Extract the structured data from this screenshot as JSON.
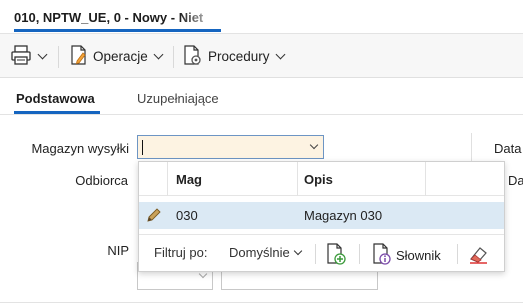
{
  "window": {
    "tab_title": "010, NPTW_UE, 0 - Nowy - Niet"
  },
  "toolbar": {
    "print_icon": "printer-icon",
    "operations_label": "Operacje",
    "procedures_label": "Procedury"
  },
  "section_tabs": {
    "basic": "Podstawowa",
    "additional": "Uzupełniające"
  },
  "form": {
    "warehouse_label": "Magazyn wysyłki",
    "warehouse_value": "",
    "recipient_label": "Odbiorca",
    "nip_label": "NIP",
    "date_label_1": "Data",
    "date_label_2": "Da"
  },
  "popup": {
    "columns": [
      "Mag",
      "Opis"
    ],
    "rows": [
      {
        "mag": "030",
        "opis": "Magazyn 030"
      }
    ],
    "filter_label": "Filtruj po:",
    "filter_value": "Domyślnie",
    "dictionary_label": "Słownik"
  },
  "colors": {
    "accent": "#1565c0",
    "active_field_bg": "#fdf3e2",
    "selected_row_bg": "#dbe9f4"
  }
}
